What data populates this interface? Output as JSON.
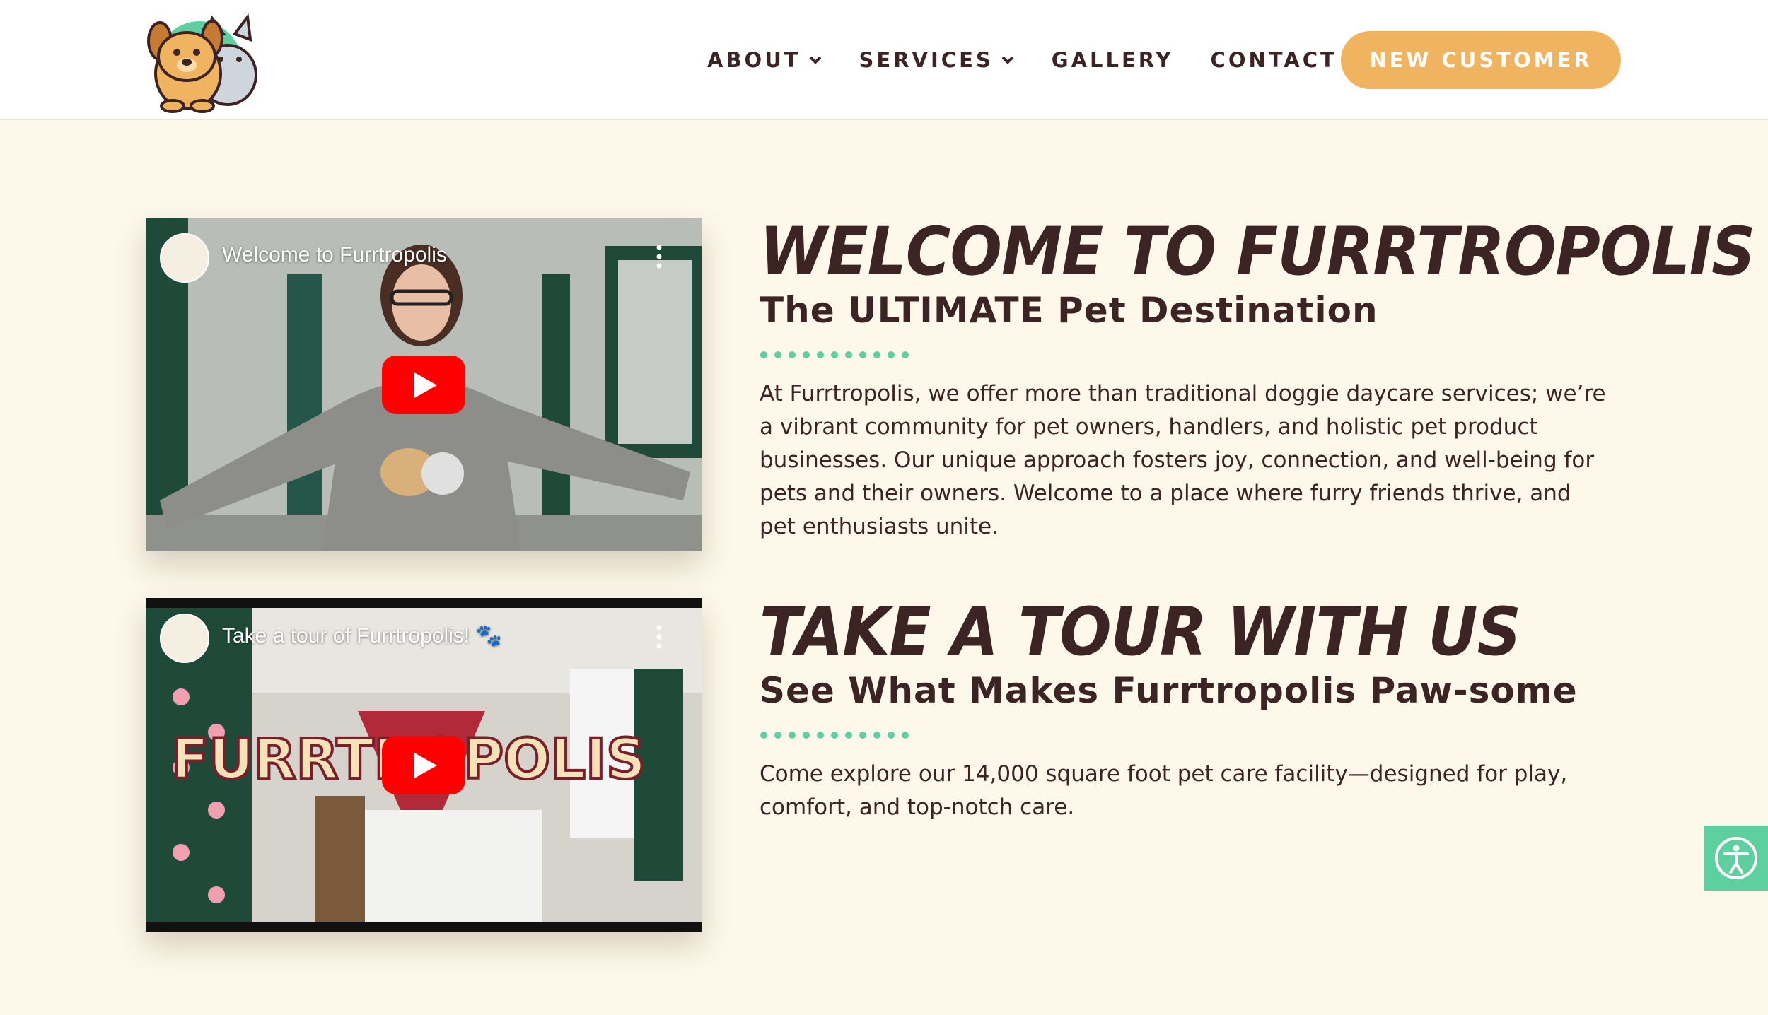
{
  "header": {
    "nav": [
      {
        "label": "ABOUT",
        "dropdown": true
      },
      {
        "label": "SERVICES",
        "dropdown": true
      },
      {
        "label": "GALLERY",
        "dropdown": false
      },
      {
        "label": "CONTACT",
        "dropdown": false
      }
    ],
    "cta_label": "NEW CUSTOMER",
    "logo_icon": "dog-and-cat-logo-icon"
  },
  "sections": [
    {
      "video_title": "Welcome to Furrtropolis",
      "heading": "WELCOME TO FURRTROPOLIS",
      "subheading": "The ULTIMATE Pet Destination",
      "body": "At Furrtropolis, we offer more than traditional doggie daycare services; we’re a vibrant community for pet owners, handlers, and holistic pet product businesses. Our unique approach fosters joy, connection, and well-being for pets and their owners. Welcome to a place where furry friends thrive, and pet enthusiasts unite."
    },
    {
      "video_title": "Take a tour of Furrtropolis! 🐾",
      "heading": "TAKE A TOUR WITH US",
      "subheading": "See What Makes Furrtropolis Paw-some",
      "body": "Come explore our 14,000 square foot pet care facility—designed for play, comfort, and top-notch care."
    }
  ],
  "colors": {
    "background": "#fdf8ea",
    "text": "#3d2424",
    "accent_orange": "#f0b35f",
    "accent_green": "#5ed0a0",
    "youtube_red": "#ff0000"
  },
  "icons": {
    "play": "youtube-play-icon",
    "menu": "more-vert-icon",
    "accessibility": "accessibility-icon",
    "chevron": "chevron-down-icon"
  }
}
